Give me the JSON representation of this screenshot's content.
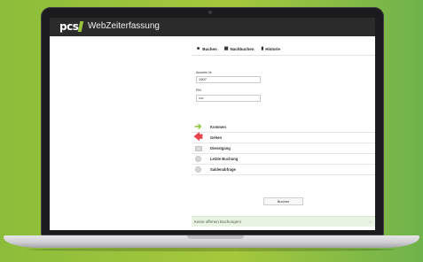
{
  "app": {
    "logo_text": "pcs",
    "title": "WebZeiterfassung"
  },
  "tabs": [
    {
      "label": "Buchen",
      "icon": "person-icon"
    },
    {
      "label": "Nachbuchen",
      "icon": "calendar-icon"
    },
    {
      "label": "Historie",
      "icon": "history-icon"
    }
  ],
  "form": {
    "ausweis_label": "Ausweis Nr.",
    "ausweis_value": "1907",
    "pin_label": "PIN",
    "pin_value": "••••"
  },
  "actions": [
    {
      "label": "Kommen",
      "icon": "arrow-right-icon",
      "color": "#8dc63f"
    },
    {
      "label": "Gehen",
      "icon": "arrow-left-icon",
      "color": "#e8424a"
    },
    {
      "label": "Dienstgang",
      "icon": "briefcase-icon"
    },
    {
      "label": "Letzte Buchung",
      "icon": "clock-icon"
    },
    {
      "label": "Saldenabfrage",
      "icon": "balance-icon"
    }
  ],
  "submit_label": "Buchen",
  "status": {
    "message": "Keine offenen Buchungen!",
    "close": "×"
  },
  "colors": {
    "background_green": "#8cbd3a",
    "accent": "#97c13b",
    "topbar": "#2b2b2b"
  }
}
